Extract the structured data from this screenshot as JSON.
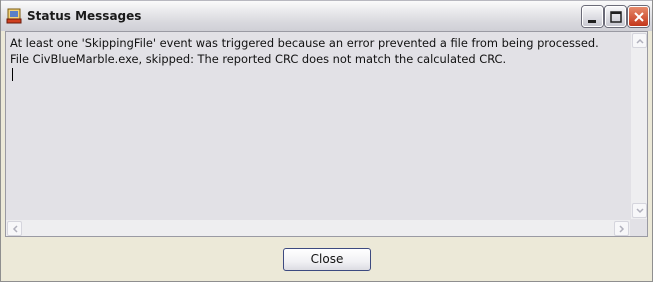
{
  "window": {
    "title": "Status Messages",
    "icon": "monitor-app-icon"
  },
  "titlebar_buttons": {
    "minimize_icon": "minimize-icon",
    "maximize_icon": "maximize-icon",
    "close_icon": "close-icon"
  },
  "messages": {
    "lines": [
      "At least one 'SkippingFile' event was triggered because an error prevented a file from being processed.",
      "File CivBlueMarble.exe, skipped: The reported CRC does not match the calculated CRC."
    ]
  },
  "footer": {
    "close_label": "Close"
  },
  "colors": {
    "window_bg": "#ece9d8",
    "textarea_bg": "#e2e1e6",
    "close_button_red": "#c4371c"
  }
}
